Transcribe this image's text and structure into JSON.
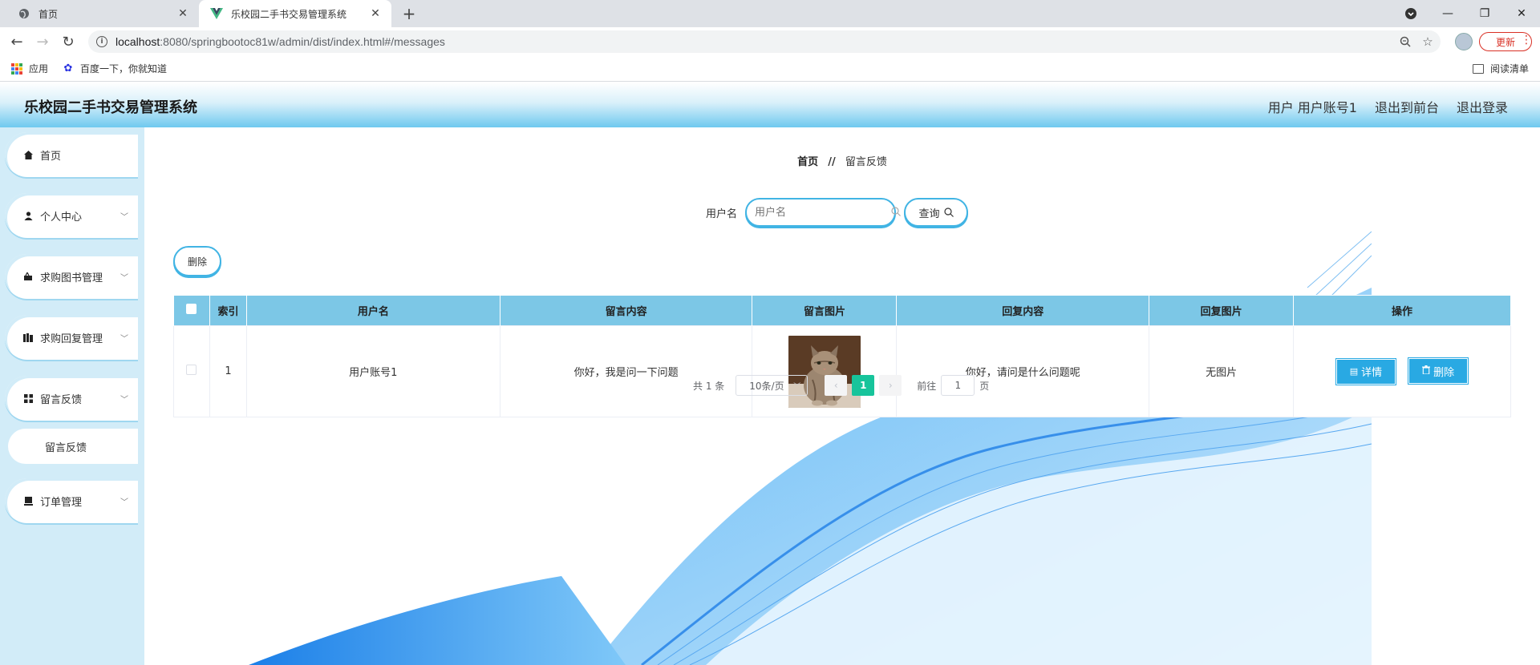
{
  "browser": {
    "tabs": [
      {
        "title": "首页",
        "active": false
      },
      {
        "title": "乐校园二手书交易管理系统",
        "active": true
      }
    ],
    "url_host": "localhost",
    "url_rest": ":8080/springbootoc81w/admin/dist/index.html#/messages",
    "update_label": "更新",
    "bookmarks": {
      "apps": "应用",
      "baidu": "百度一下，你就知道",
      "reading_list": "阅读清单"
    }
  },
  "header": {
    "title": "乐校园二手书交易管理系统",
    "user_label": "用户 用户账号1",
    "to_front": "退出到前台",
    "logout": "退出登录"
  },
  "sidebar": {
    "items": [
      {
        "label": "首页",
        "icon": "home-icon"
      },
      {
        "label": "个人中心",
        "icon": "user-icon"
      },
      {
        "label": "求购图书管理",
        "icon": "cart-icon"
      },
      {
        "label": "求购回复管理",
        "icon": "reply-icon"
      },
      {
        "label": "留言反馈",
        "icon": "grid-icon"
      },
      {
        "label": "订单管理",
        "icon": "order-icon"
      }
    ],
    "sub_item": "留言反馈"
  },
  "breadcrumb": {
    "home": "首页",
    "sep": "//",
    "current": "留言反馈"
  },
  "search": {
    "label": "用户名",
    "placeholder": "用户名",
    "button": "查询"
  },
  "toolbar": {
    "delete": "删除"
  },
  "table": {
    "headers": [
      "索引",
      "用户名",
      "留言内容",
      "留言图片",
      "回复内容",
      "回复图片",
      "操作"
    ],
    "rows": [
      {
        "index": "1",
        "username": "用户账号1",
        "content": "你好，我是问一下问题",
        "reply": "你好，请问是什么问题呢",
        "reply_image": "无图片",
        "detail": "详情",
        "delete": "删除"
      }
    ]
  },
  "pagination": {
    "total": "共 1 条",
    "page_size": "10条/页",
    "current_page": "1",
    "goto_prefix": "前往",
    "goto_value": "1",
    "goto_suffix": "页"
  },
  "colors": {
    "accent": "#41b4e4",
    "table_header": "#7cc7e6",
    "pager_active": "#17c49b",
    "sidebar_bg": "#d2ecf8"
  }
}
